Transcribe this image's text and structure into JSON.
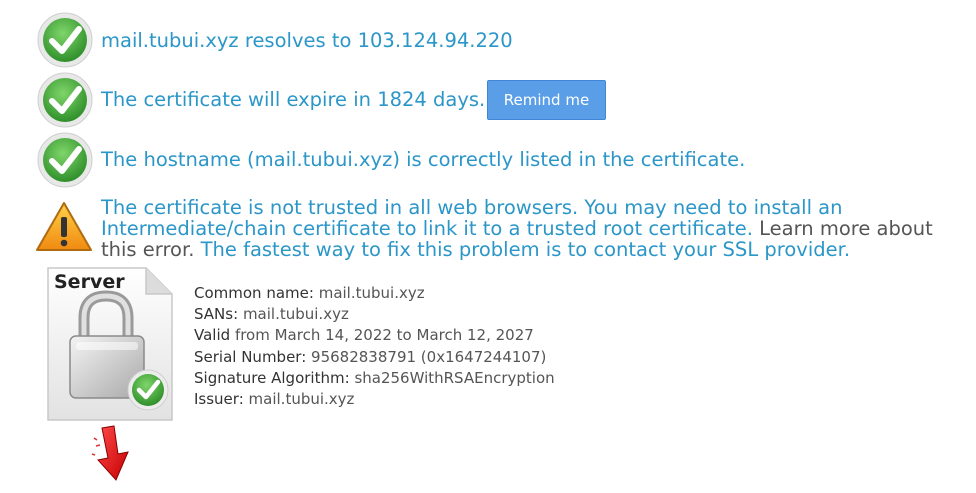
{
  "checks": [
    {
      "text": "mail.tubui.xyz resolves to 103.124.94.220"
    },
    {
      "text": "The certificate will expire in 1824 days."
    },
    {
      "text": "The hostname (mail.tubui.xyz) is correctly listed in the certificate."
    }
  ],
  "remind_button": {
    "label": "Remind me"
  },
  "warning": {
    "line1": "The certificate is not trusted in all web browsers. You may need to install an",
    "line2_blue": "Intermediate/chain certificate to link it to a trusted root certificate.",
    "line2_plain": "Learn more about",
    "line3_plain": "this error.",
    "line3_blue": "The fastest way to fix this problem is to contact your SSL provider."
  },
  "server_icon": {
    "label": "Server"
  },
  "certificate": [
    {
      "key": "Common name:",
      "value": "mail.tubui.xyz"
    },
    {
      "key": "SANs:",
      "value": "mail.tubui.xyz"
    },
    {
      "key": "Valid",
      "value": "from March 14, 2022 to March 12, 2027"
    },
    {
      "key": "Serial Number:",
      "value": "95682838791 (0x1647244107)"
    },
    {
      "key": "Signature Algorithm:",
      "value": "sha256WithRSAEncryption"
    },
    {
      "key": "Issuer:",
      "value": "mail.tubui.xyz"
    }
  ],
  "colors": {
    "accent": "#2b96c8",
    "button": "#5a9ee8",
    "check_green": "#3aa83a",
    "warning_orange": "#f0a020"
  }
}
